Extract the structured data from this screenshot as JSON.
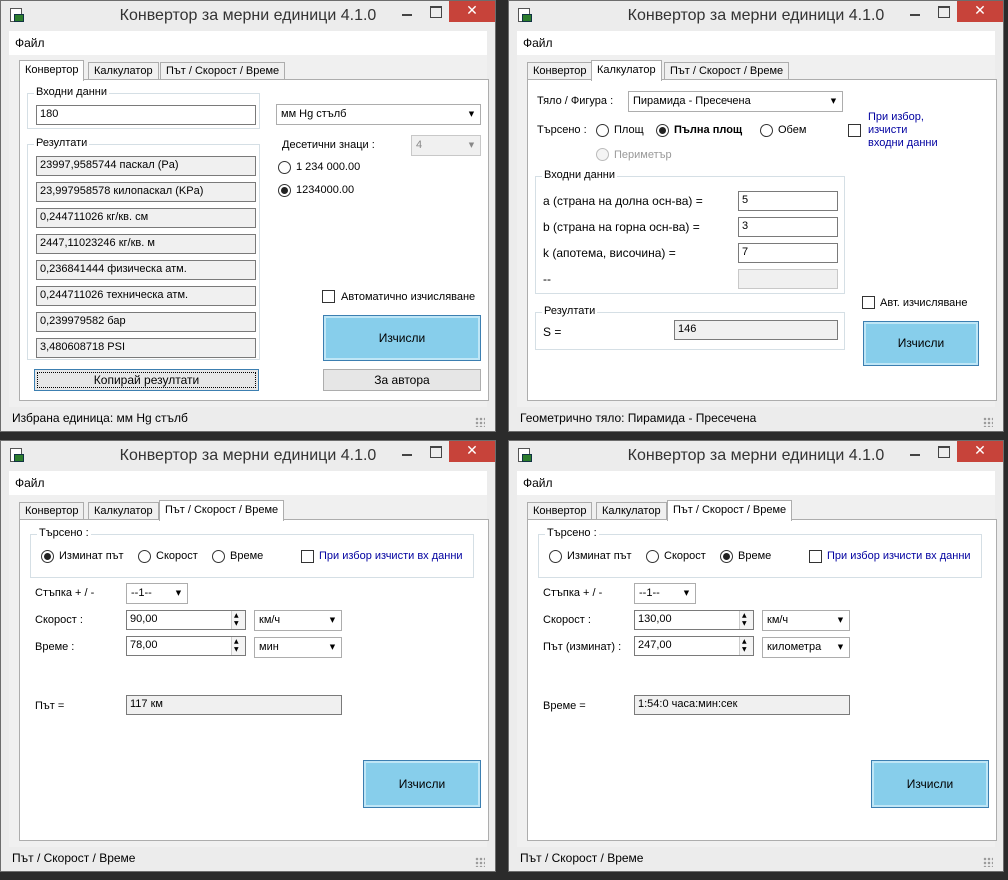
{
  "window_title": "Конвертор за мерни единици 4.1.0",
  "close_glyph": "✕",
  "menu_file": "Файл",
  "tab_converter": "Конвертор",
  "tab_calculator": "Калкулатор",
  "tab_travel": "Път / Скорост / Време",
  "combo_arrow": "▼",
  "spin_up": "▲",
  "spin_down": "▼",
  "converter": {
    "input_group": "Входни данни",
    "input_value": "180",
    "unit": "мм Hg стълб",
    "decimals_label": "Десетични знаци :",
    "decimals_value": "4",
    "format_option_1": "1 234 000.00",
    "format_option_2": "1234000.00",
    "format_selected": 2,
    "results_group": "Резултати",
    "results": [
      "23997,9585744 паскал (Pa)",
      "23,997958578 килопаскал (KPa)",
      "0,244711026 кг/кв. см",
      "2447,11023246 кг/кв. м",
      "0,236841444 физическа атм.",
      "0,244711026 техническа атм.",
      "0,239979582 бар",
      "3,480608718 PSI"
    ],
    "auto_calc_label": "Автоматично изчисляване",
    "auto_calc_checked": false,
    "calc_button": "Изчисли",
    "copy_button": "Копирай резултати",
    "about_button": "За автора",
    "status": "Избрана единица: мм Hg стълб"
  },
  "calculator": {
    "figure_label": "Тяло / Фигура :",
    "figure_value": "Пирамида - Пресечена",
    "sought_label": "Търсено :",
    "opt_area": "Площ",
    "opt_full_area": "Пълна площ",
    "opt_volume": "Обем",
    "opt_perimeter": "Периметър",
    "selected": "full_area",
    "clear_checkbox_label_1": "При избор,",
    "clear_checkbox_label_2": "изчисти",
    "clear_checkbox_label_3": "входни данни",
    "clear_checked": false,
    "input_group": "Входни данни",
    "a_label": "a (страна на долна осн-ва) =",
    "a_value": "5",
    "b_label": "b (страна на горна осн-ва) =",
    "b_value": "3",
    "k_label": "k (апотема, височина) =",
    "k_value": "7",
    "extra_label": "--",
    "results_group": "Резултати",
    "s_label": "S =",
    "s_value": "146",
    "auto_label": "Авт. изчисляване",
    "auto_checked": false,
    "calc_button": "Изчисли",
    "status": "Геометрично тяло:  Пирамида - Пресечена"
  },
  "travel_distance": {
    "sought_group": "Търсено :",
    "opt_distance": "Изминат път",
    "opt_speed": "Скорост",
    "opt_time": "Време",
    "selected": "distance",
    "clear_label": "При избор изчисти вх данни",
    "clear_checked": false,
    "step_label": "Стъпка + / -",
    "step_value": "--1--",
    "speed_label": "Скорост :",
    "speed_value": "90,00",
    "speed_unit": "км/ч",
    "time_label": "Време :",
    "time_value": "78,00",
    "time_unit": "мин",
    "result_label": "Път =",
    "result_value": "117 км",
    "calc_button": "Изчисли",
    "status": "Път / Скорост / Време"
  },
  "travel_time": {
    "sought_group": "Търсено :",
    "opt_distance": "Изминат път",
    "opt_speed": "Скорост",
    "opt_time": "Време",
    "selected": "time",
    "clear_label": "При избор изчисти вх данни",
    "clear_checked": false,
    "step_label": "Стъпка + / -",
    "step_value": "--1--",
    "speed_label": "Скорост :",
    "speed_value": "130,00",
    "speed_unit": "км/ч",
    "distance_label": "Път (изминат) :",
    "distance_value": "247,00",
    "distance_unit": "километра",
    "result_label": "Време =",
    "result_value": "1:54:0 часа:мин:сек",
    "calc_button": "Изчисли",
    "status": "Път / Скорост / Време"
  }
}
